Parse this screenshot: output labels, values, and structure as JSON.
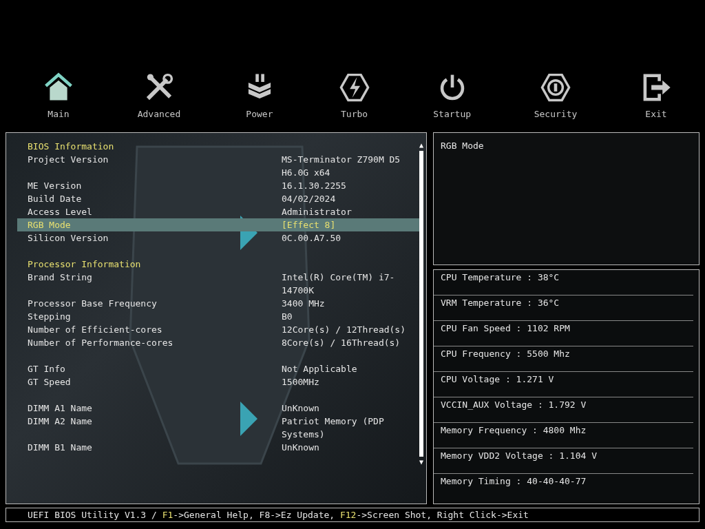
{
  "tabs": [
    {
      "label": "Main",
      "selected": true
    },
    {
      "label": "Advanced",
      "selected": false
    },
    {
      "label": "Power",
      "selected": false
    },
    {
      "label": "Turbo",
      "selected": false
    },
    {
      "label": "Startup",
      "selected": false
    },
    {
      "label": "Security",
      "selected": false
    },
    {
      "label": "Exit",
      "selected": false
    }
  ],
  "scrollbar": {
    "up": "▲",
    "down": "▼"
  },
  "info_groups": [
    {
      "title": "BIOS Information",
      "items": [
        {
          "label": "Project Version",
          "value": "MS-Terminator Z790M D5 H6.0G x64",
          "selected": false
        },
        {
          "label": "ME Version",
          "value": "16.1.30.2255",
          "selected": false
        },
        {
          "label": "Build Date",
          "value": "04/02/2024",
          "selected": false
        },
        {
          "label": "Access Level",
          "value": "Administrator",
          "selected": false
        },
        {
          "label": "RGB Mode",
          "value": "[Effect 8]",
          "selected": true
        },
        {
          "label": "Silicon Version",
          "value": "0C.00.A7.50",
          "selected": false
        }
      ]
    },
    {
      "title": "Processor Information",
      "items": [
        {
          "label": "Brand String",
          "value": "Intel(R) Core(TM) i7-14700K",
          "selected": false
        },
        {
          "label": "Processor Base Frequency",
          "value": "3400 MHz",
          "selected": false
        },
        {
          "label": "Stepping",
          "value": "B0",
          "selected": false
        },
        {
          "label": "Number of Efficient-cores",
          "value": "12Core(s) / 12Thread(s)",
          "selected": false
        },
        {
          "label": "Number of Performance-cores",
          "value": "8Core(s) / 16Thread(s)",
          "selected": false
        }
      ]
    },
    {
      "items": [
        {
          "label": "GT Info",
          "value": "Not Applicable",
          "selected": false
        },
        {
          "label": "GT Speed",
          "value": "1500MHz",
          "selected": false
        }
      ]
    },
    {
      "items": [
        {
          "label": "DIMM A1 Name",
          "value": "UnKnown",
          "selected": false
        },
        {
          "label": "DIMM A2 Name",
          "value": "Patriot Memory (PDP Systems)",
          "selected": false
        },
        {
          "label": "DIMM B1 Name",
          "value": "UnKnown",
          "selected": false
        }
      ]
    }
  ],
  "help_panel": {
    "text": "RGB Mode"
  },
  "monitor": [
    "CPU Temperature : 38°C",
    "VRM Temperature : 36°C",
    "CPU Fan Speed : 1102 RPM",
    "CPU Frequency : 5500 Mhz",
    "CPU Voltage : 1.271 V",
    "VCCIN_AUX Voltage : 1.792 V",
    "Memory Frequency : 4800 Mhz",
    "Memory VDD2 Voltage : 1.104 V",
    "Memory Timing : 40-40-40-77"
  ],
  "status_bar": [
    {
      "text": "UEFI BIOS Utility V1.3 / ",
      "key": false
    },
    {
      "text": "F1",
      "key": true
    },
    {
      "text": "->General Help, F8->Ez Update, ",
      "key": false
    },
    {
      "text": "F12",
      "key": true
    },
    {
      "text": "->Screen Shot, Right Click->Exit",
      "key": false
    }
  ]
}
